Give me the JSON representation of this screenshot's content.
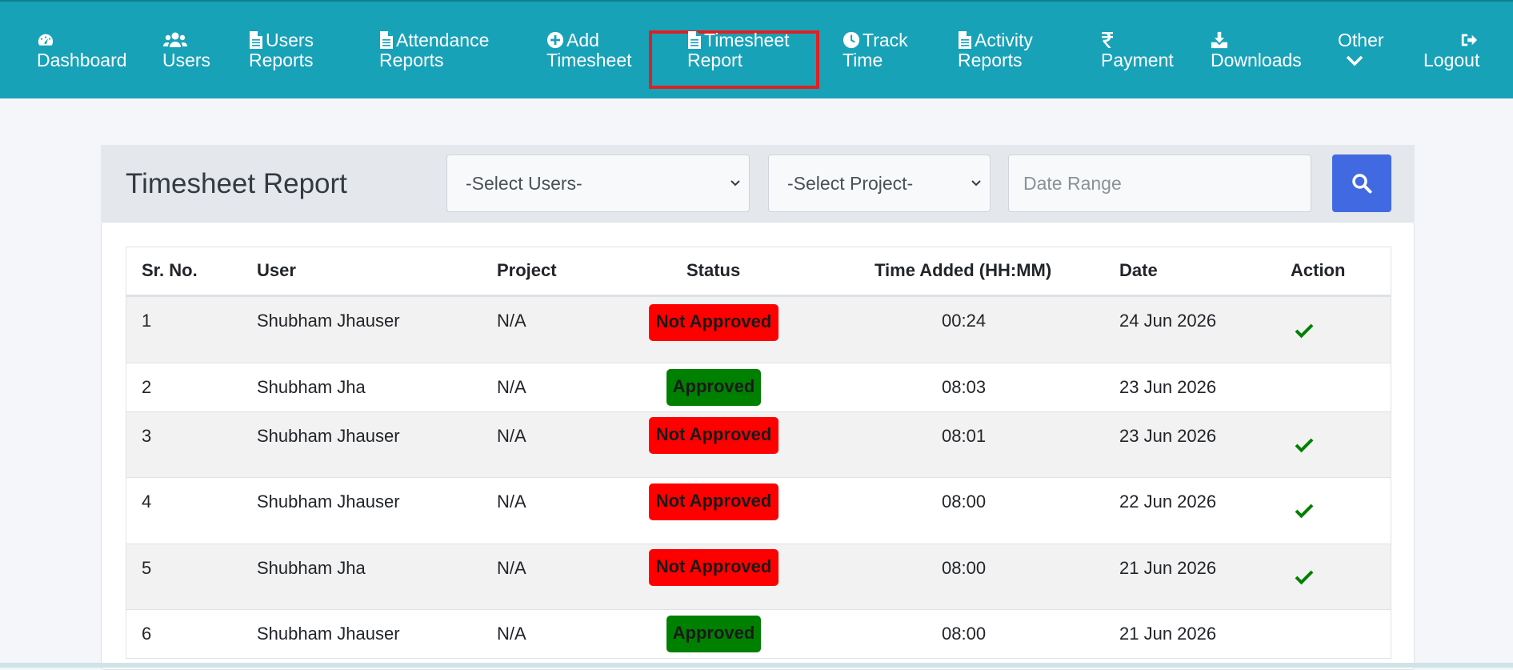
{
  "nav": {
    "items": [
      {
        "icon": "dashboard-icon",
        "line1": "",
        "line2": "Dashboard"
      },
      {
        "icon": "users-icon",
        "line1": "",
        "line2": "Users"
      },
      {
        "icon": "document-icon",
        "line1": "Users",
        "line2": "Reports"
      },
      {
        "icon": "document-icon",
        "line1": "Attendance",
        "line2": "Reports"
      },
      {
        "icon": "plus-circle-icon",
        "line1": "Add",
        "line2": "Timesheet"
      },
      {
        "icon": "document-icon",
        "line1": "Timesheet",
        "line2": "Report"
      },
      {
        "icon": "clock-icon",
        "line1": "Track",
        "line2": "Time"
      },
      {
        "icon": "document-icon",
        "line1": "Activity",
        "line2": "Reports"
      },
      {
        "icon": "rupee-icon",
        "line1": "",
        "line2": "Payment"
      },
      {
        "icon": "download-icon",
        "line1": "",
        "line2": "Downloads"
      },
      {
        "icon": "chevron-down-icon",
        "line1": "Other",
        "line2": ""
      },
      {
        "icon": "logout-icon",
        "line1": "",
        "line2": "Logout"
      }
    ],
    "active_index": 5,
    "bg_color": "#17a2b8",
    "highlight_color": "#e02020"
  },
  "header": {
    "title": "Timesheet Report",
    "select_users": "-Select Users-",
    "select_project": "-Select Project-",
    "date_placeholder": "Date Range",
    "search_color": "#4169e1"
  },
  "table": {
    "columns": [
      "Sr. No.",
      "User",
      "Project",
      "Status",
      "Time Added (HH:MM)",
      "Date",
      "Action"
    ],
    "rows": [
      {
        "sr": "1",
        "user": "Shubham Jhauser",
        "project": "N/A",
        "status": "Not Approved",
        "time": "00:24",
        "date": "24 Jun 2026",
        "action": true
      },
      {
        "sr": "2",
        "user": "Shubham Jha",
        "project": "N/A",
        "status": "Approved",
        "time": "08:03",
        "date": "23 Jun 2026",
        "action": false
      },
      {
        "sr": "3",
        "user": "Shubham Jhauser",
        "project": "N/A",
        "status": "Not Approved",
        "time": "08:01",
        "date": "23 Jun 2026",
        "action": true
      },
      {
        "sr": "4",
        "user": "Shubham Jhauser",
        "project": "N/A",
        "status": "Not Approved",
        "time": "08:00",
        "date": "22 Jun 2026",
        "action": true
      },
      {
        "sr": "5",
        "user": "Shubham Jha",
        "project": "N/A",
        "status": "Not Approved",
        "time": "08:00",
        "date": "21 Jun 2026",
        "action": true
      },
      {
        "sr": "6",
        "user": "Shubham Jhauser",
        "project": "N/A",
        "status": "Approved",
        "time": "08:00",
        "date": "21 Jun 2026",
        "action": false
      }
    ],
    "status_colors": {
      "not_approved": "#ff0000",
      "approved": "#008000"
    },
    "check_color": "#008000"
  }
}
